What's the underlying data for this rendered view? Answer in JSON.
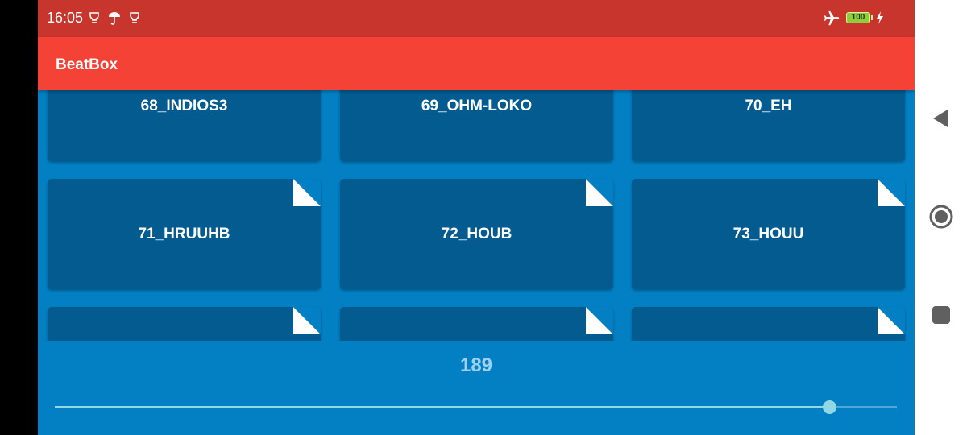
{
  "status_bar": {
    "time": "16:05",
    "battery_level": "100",
    "icons": [
      "notification-icon",
      "umbrella-icon",
      "notification-icon",
      "airplane-mode-icon",
      "battery-icon",
      "charging-icon"
    ],
    "background_color": "#c8352c"
  },
  "app_bar": {
    "title": "BeatBox",
    "background_color": "#f44336"
  },
  "sounds": {
    "row1": [
      "68_INDIOS3",
      "69_OHM-LOKO",
      "70_EH"
    ],
    "row2": [
      "71_HRUUHB",
      "72_HOUB",
      "73_HOUU"
    ],
    "row3": [
      "",
      "",
      ""
    ]
  },
  "playback": {
    "rate_value": "189",
    "slider_fraction": 0.92
  },
  "nav_bar": {
    "buttons": [
      "back-icon",
      "home-icon",
      "recents-icon"
    ]
  },
  "colors": {
    "background": "#0380c4",
    "tile": "#035b8f",
    "slider": "#8fd8e4"
  }
}
